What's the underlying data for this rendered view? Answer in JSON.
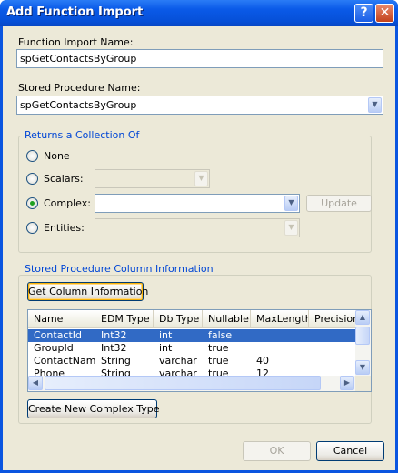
{
  "window": {
    "title": "Add Function Import",
    "help_glyph": "?",
    "close_glyph": "✕"
  },
  "function_import": {
    "label": "Function Import Name:",
    "value": "spGetContactsByGroup"
  },
  "stored_procedure": {
    "label": "Stored Procedure Name:",
    "value": "spGetContactsByGroup"
  },
  "returns": {
    "title": "Returns a Collection Of",
    "options": [
      {
        "label": "None",
        "selected": false
      },
      {
        "label": "Scalars:",
        "selected": false
      },
      {
        "label": "Complex:",
        "selected": true
      },
      {
        "label": "Entities:",
        "selected": false
      }
    ],
    "update_label": "Update"
  },
  "column_info": {
    "title": "Stored Procedure Column Information",
    "get_button": "Get Column Information",
    "columns": [
      "Name",
      "EDM Type",
      "Db Type",
      "Nullable",
      "MaxLength",
      "Precision"
    ],
    "rows": [
      {
        "name": "ContactId",
        "edm": "Int32",
        "db": "int",
        "nullable": "false",
        "maxlength": "",
        "selected": true
      },
      {
        "name": "GroupId",
        "edm": "Int32",
        "db": "int",
        "nullable": "true",
        "maxlength": "",
        "selected": false
      },
      {
        "name": "ContactName",
        "edm": "String",
        "db": "varchar",
        "nullable": "true",
        "maxlength": "40",
        "selected": false
      },
      {
        "name": "Phone",
        "edm": "String",
        "db": "varchar",
        "nullable": "true",
        "maxlength": "12",
        "selected": false
      }
    ],
    "create_button": "Create New Complex Type"
  },
  "footer": {
    "ok_label": "OK",
    "cancel_label": "Cancel"
  },
  "icons": {
    "combo_arrow": "chevron-down-icon",
    "scroll_up": "arrow-up-icon",
    "scroll_down": "arrow-down-icon",
    "scroll_left": "arrow-left-icon",
    "scroll_right": "arrow-right-icon"
  },
  "colors": {
    "titlebar": "#0a5ae8",
    "dialog_bg": "#ece9d8",
    "selection": "#316ac5",
    "group_title": "#0046d5"
  }
}
